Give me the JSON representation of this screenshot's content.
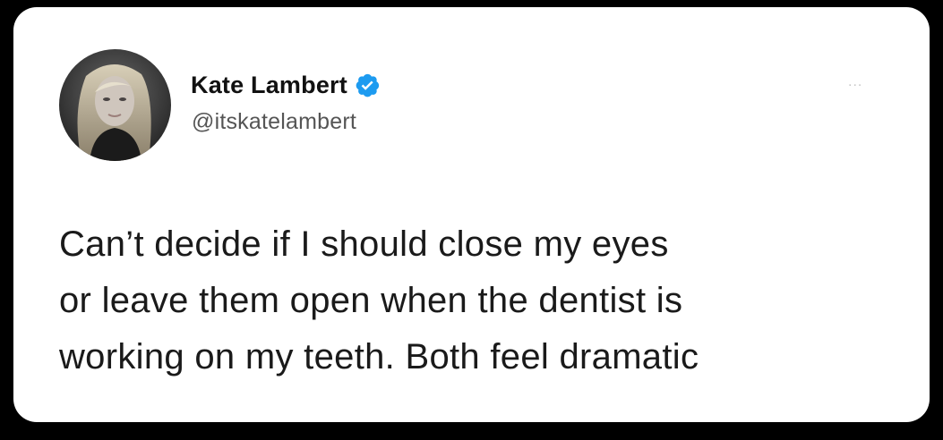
{
  "tweet": {
    "author": {
      "display_name": "Kate Lambert",
      "handle": "@itskatelambert",
      "verified": true,
      "avatar_icon": "profile-photo"
    },
    "more_menu": "...",
    "text_lines": [
      "Can’t decide if I should close my eyes",
      "or leave them open when the dentist is",
      "working on my teeth. Both feel dramatic"
    ]
  },
  "colors": {
    "background": "#000000",
    "card": "#ffffff",
    "verified_badge": "#1d9bf0",
    "text": "#1a1a1a",
    "handle": "#555555"
  }
}
